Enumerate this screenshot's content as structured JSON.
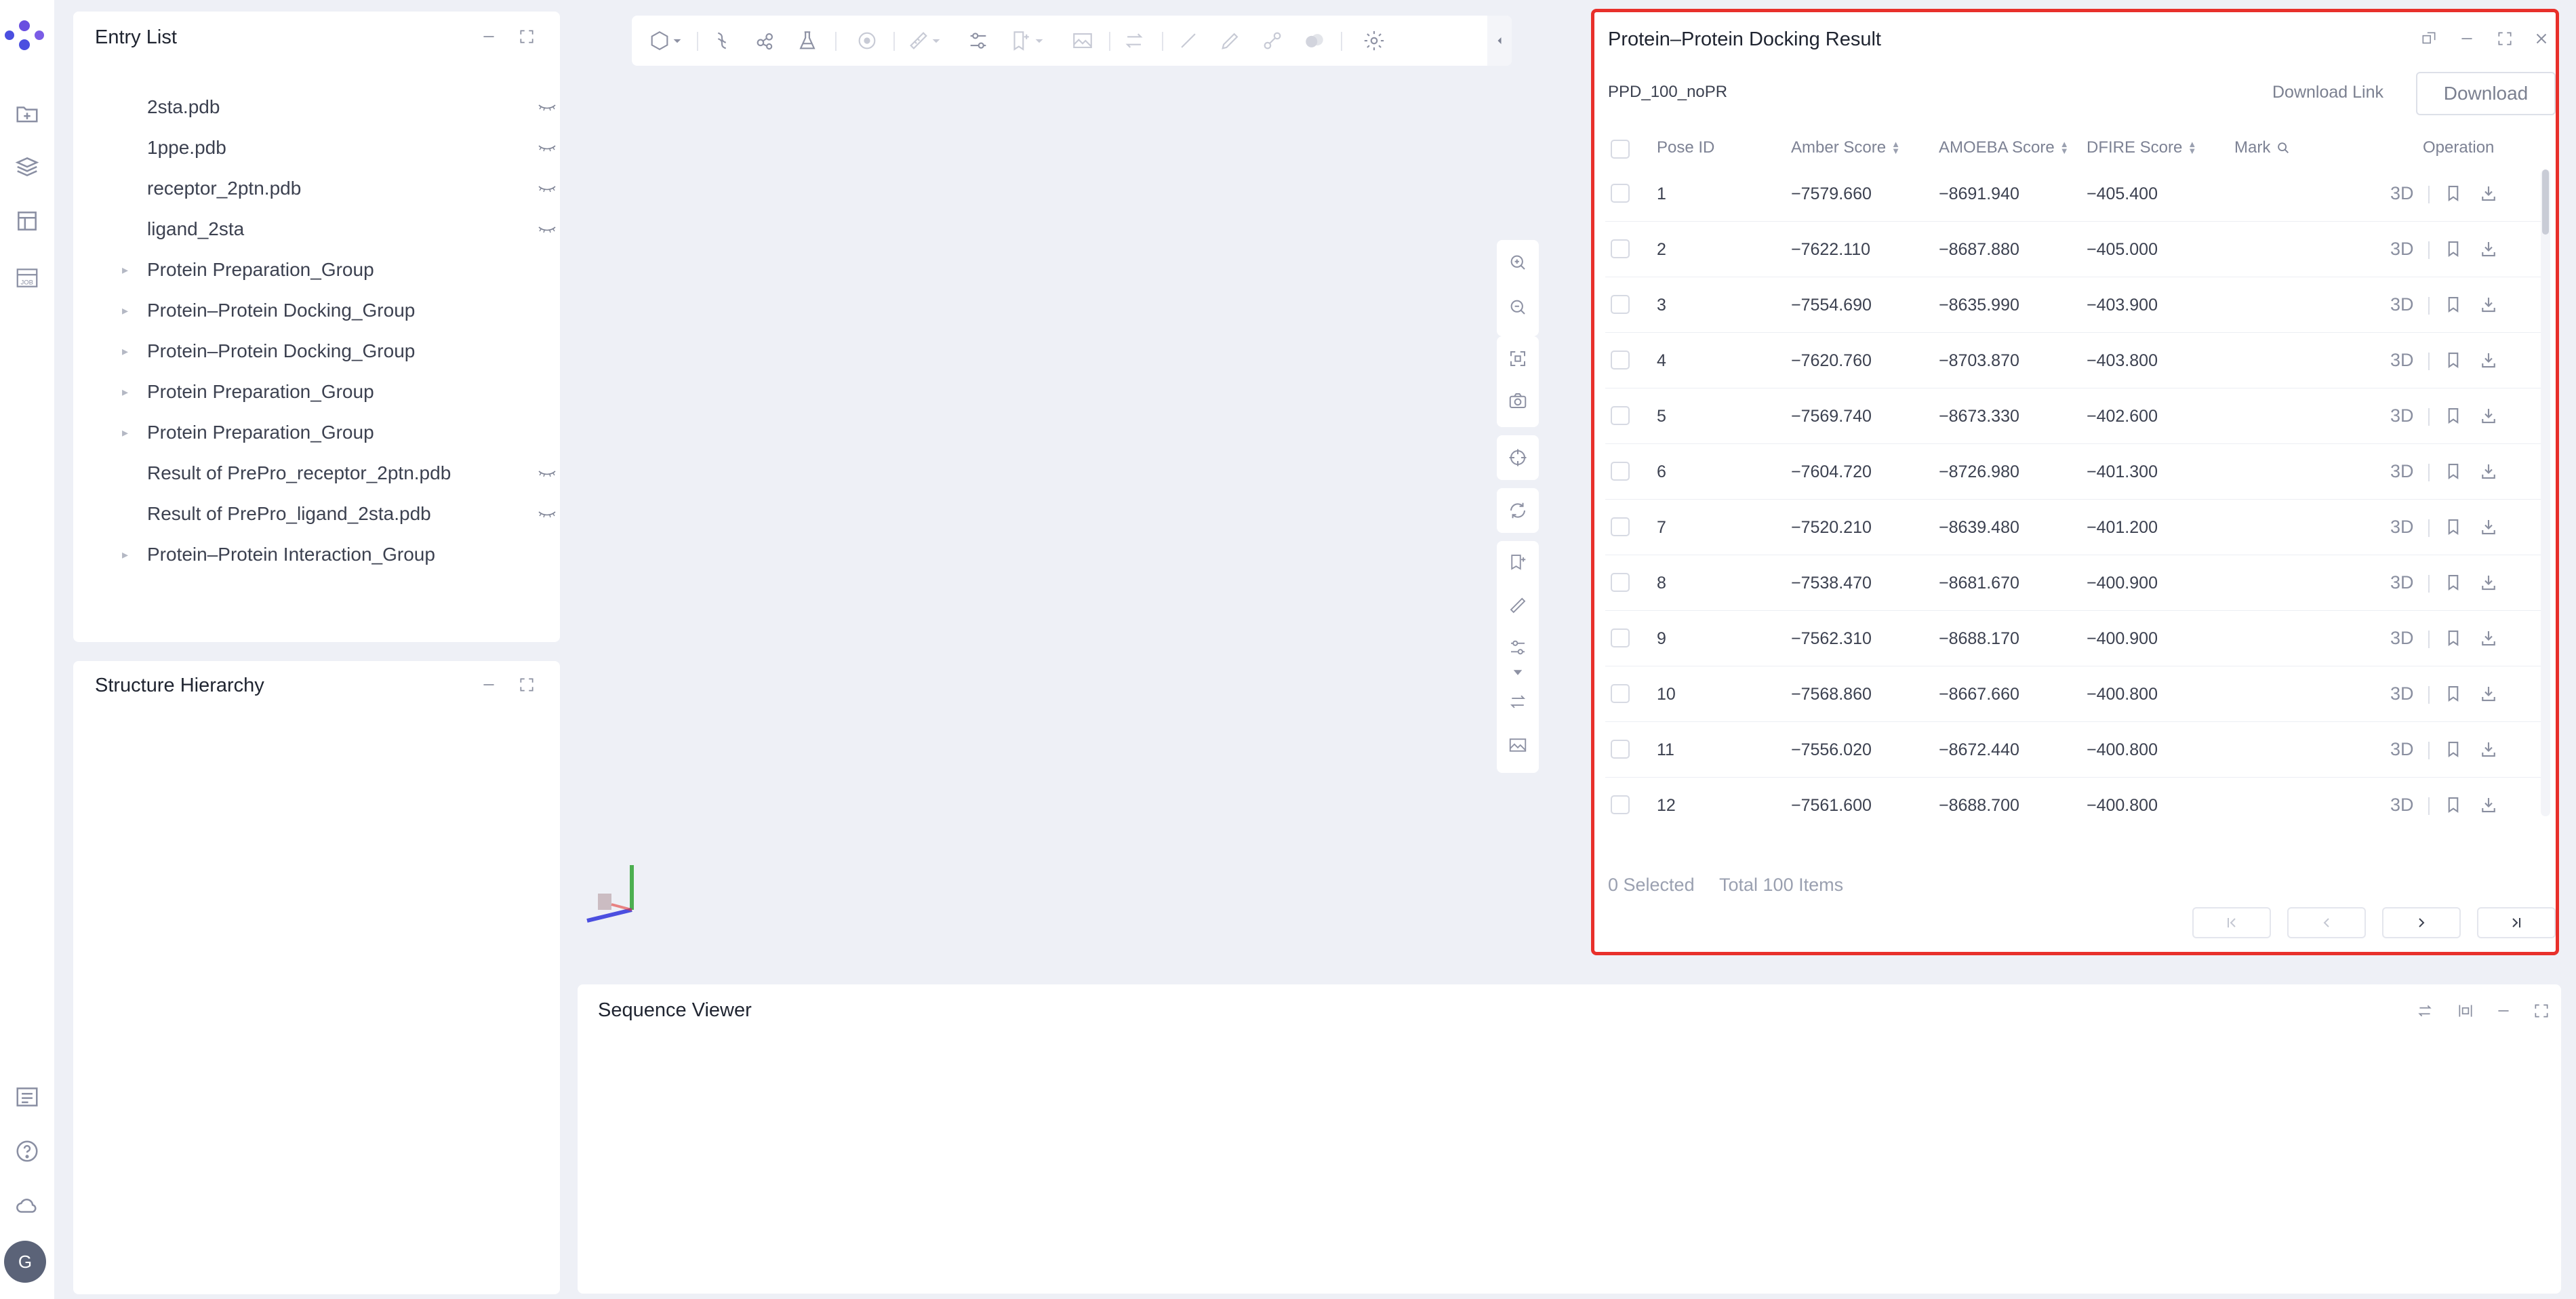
{
  "entry_list": {
    "title": "Entry List",
    "items": [
      {
        "label": "2sta.pdb",
        "has_eye": true,
        "group": false
      },
      {
        "label": "1ppe.pdb",
        "has_eye": true,
        "group": false
      },
      {
        "label": "receptor_2ptn.pdb",
        "has_eye": true,
        "group": false
      },
      {
        "label": "ligand_2sta",
        "has_eye": true,
        "group": false
      },
      {
        "label": "Protein Preparation_Group",
        "has_eye": false,
        "group": true
      },
      {
        "label": "Protein–Protein Docking_Group",
        "has_eye": false,
        "group": true
      },
      {
        "label": "Protein–Protein Docking_Group",
        "has_eye": false,
        "group": true
      },
      {
        "label": "Protein Preparation_Group",
        "has_eye": false,
        "group": true
      },
      {
        "label": "Protein Preparation_Group",
        "has_eye": false,
        "group": true
      },
      {
        "label": "Result of PrePro_receptor_2ptn.pdb",
        "has_eye": true,
        "group": false
      },
      {
        "label": "Result of PrePro_ligand_2sta.pdb",
        "has_eye": true,
        "group": false
      },
      {
        "label": "Protein–Protein Interaction_Group",
        "has_eye": false,
        "group": true
      }
    ]
  },
  "structure_hierarchy": {
    "title": "Structure Hierarchy"
  },
  "sequence_viewer": {
    "title": "Sequence Viewer"
  },
  "docking_result": {
    "title": "Protein–Protein Docking Result",
    "job_name": "PPD_100_noPR",
    "download_link_label": "Download Link",
    "download_label": "Download",
    "columns": {
      "pose_id": "Pose ID",
      "amber": "Amber Score",
      "amoeba": "AMOEBA Score",
      "dfire": "DFIRE Score",
      "mark": "Mark",
      "operation": "Operation"
    },
    "op_3d_label": "3D",
    "rows": [
      {
        "pose": "1",
        "amber": "−7579.660",
        "amoeba": "−8691.940",
        "dfire": "−405.400"
      },
      {
        "pose": "2",
        "amber": "−7622.110",
        "amoeba": "−8687.880",
        "dfire": "−405.000"
      },
      {
        "pose": "3",
        "amber": "−7554.690",
        "amoeba": "−8635.990",
        "dfire": "−403.900"
      },
      {
        "pose": "4",
        "amber": "−7620.760",
        "amoeba": "−8703.870",
        "dfire": "−403.800"
      },
      {
        "pose": "5",
        "amber": "−7569.740",
        "amoeba": "−8673.330",
        "dfire": "−402.600"
      },
      {
        "pose": "6",
        "amber": "−7604.720",
        "amoeba": "−8726.980",
        "dfire": "−401.300"
      },
      {
        "pose": "7",
        "amber": "−7520.210",
        "amoeba": "−8639.480",
        "dfire": "−401.200"
      },
      {
        "pose": "8",
        "amber": "−7538.470",
        "amoeba": "−8681.670",
        "dfire": "−400.900"
      },
      {
        "pose": "9",
        "amber": "−7562.310",
        "amoeba": "−8688.170",
        "dfire": "−400.900"
      },
      {
        "pose": "10",
        "amber": "−7568.860",
        "amoeba": "−8667.660",
        "dfire": "−400.800"
      },
      {
        "pose": "11",
        "amber": "−7556.020",
        "amoeba": "−8672.440",
        "dfire": "−400.800"
      },
      {
        "pose": "12",
        "amber": "−7561.600",
        "amoeba": "−8688.700",
        "dfire": "−400.800"
      }
    ],
    "selected_text": "0 Selected",
    "total_text": "Total 100 Items",
    "highlight_color": "#e8302b"
  },
  "avatar_initial": "G",
  "colors": {
    "brand": "#4b4fe0",
    "background": "#eef0f6"
  }
}
